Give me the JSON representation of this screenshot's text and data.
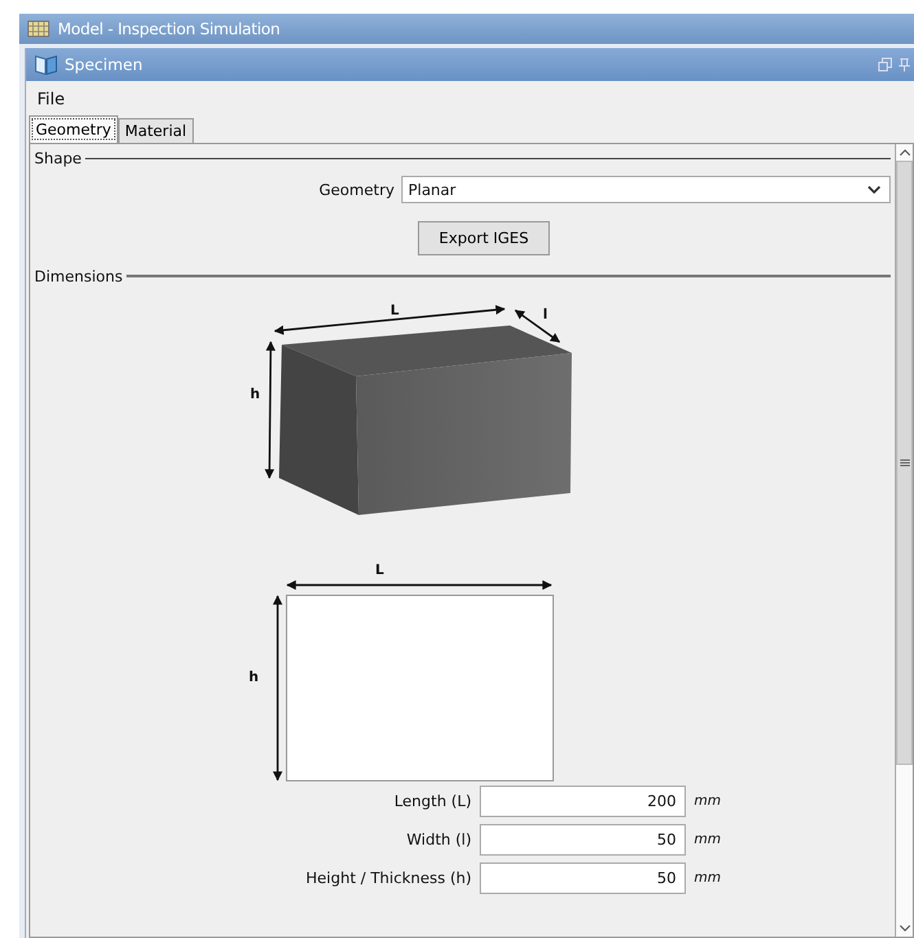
{
  "window": {
    "title": "Model - Inspection Simulation"
  },
  "panel": {
    "title": "Specimen"
  },
  "menu": [
    "File"
  ],
  "tabs": [
    {
      "label": "Geometry",
      "selected": true
    },
    {
      "label": "Material",
      "selected": false
    }
  ],
  "shape": {
    "heading": "Shape",
    "geometry_label": "Geometry",
    "geometry_value": "Planar",
    "export_button": "Export IGES"
  },
  "dimensions": {
    "heading": "Dimensions",
    "box_labels": {
      "length": "L",
      "width": "l",
      "height": "h"
    },
    "front_labels": {
      "length": "L",
      "height": "h"
    },
    "fields": [
      {
        "label": "Length (L)",
        "value": "200",
        "unit": "mm"
      },
      {
        "label": "Width (l)",
        "value": "50",
        "unit": "mm"
      },
      {
        "label": "Height / Thickness (h)",
        "value": "50",
        "unit": "mm"
      }
    ]
  }
}
